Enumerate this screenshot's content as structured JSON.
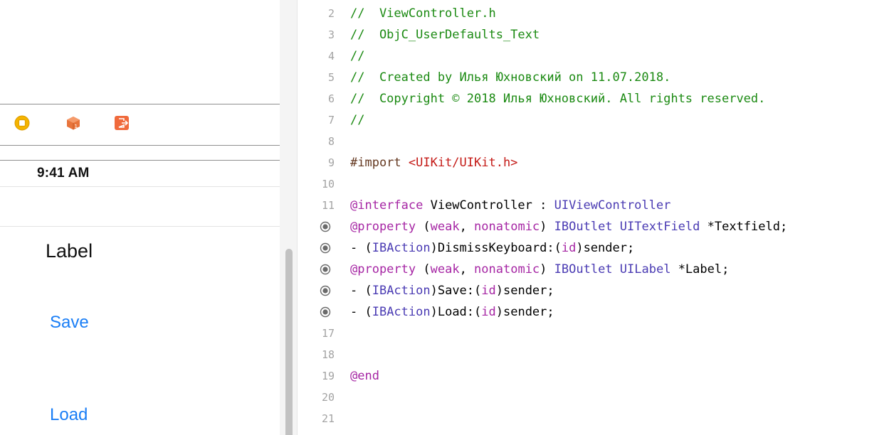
{
  "storyboard": {
    "dock_icons": [
      "view-controller-icon",
      "first-responder-icon",
      "exit-icon"
    ],
    "status_time": "9:41 AM",
    "label_text": "Label",
    "save_label": "Save",
    "load_label": "Load",
    "accent_color": "#1a7ef6"
  },
  "editor": {
    "lines": [
      {
        "num": "2",
        "connector": false,
        "segs": [
          {
            "c": "cmt",
            "t": "//  ViewController.h"
          }
        ]
      },
      {
        "num": "3",
        "connector": false,
        "segs": [
          {
            "c": "cmt",
            "t": "//  ObjC_UserDefaults_Text"
          }
        ]
      },
      {
        "num": "4",
        "connector": false,
        "segs": [
          {
            "c": "cmt",
            "t": "//"
          }
        ]
      },
      {
        "num": "5",
        "connector": false,
        "segs": [
          {
            "c": "cmt",
            "t": "//  Created by Илья Юхновский on 11.07.2018."
          }
        ]
      },
      {
        "num": "6",
        "connector": false,
        "segs": [
          {
            "c": "cmt",
            "t": "//  Copyright © 2018 Илья Юхновский. All rights reserved."
          }
        ]
      },
      {
        "num": "7",
        "connector": false,
        "segs": [
          {
            "c": "cmt",
            "t": "//"
          }
        ]
      },
      {
        "num": "8",
        "connector": false,
        "segs": []
      },
      {
        "num": "9",
        "connector": false,
        "segs": [
          {
            "c": "pp",
            "t": "#import "
          },
          {
            "c": "str",
            "t": "<UIKit/UIKit.h>"
          }
        ]
      },
      {
        "num": "10",
        "connector": false,
        "segs": []
      },
      {
        "num": "11",
        "connector": false,
        "segs": [
          {
            "c": "kw",
            "t": "@interface"
          },
          {
            "c": "pl",
            "t": " ViewController : "
          },
          {
            "c": "ty",
            "t": "UIViewController"
          }
        ]
      },
      {
        "num": "12",
        "connector": true,
        "segs": [
          {
            "c": "kw",
            "t": "@property"
          },
          {
            "c": "pl",
            "t": " ("
          },
          {
            "c": "kw",
            "t": "weak"
          },
          {
            "c": "pl",
            "t": ", "
          },
          {
            "c": "kw",
            "t": "nonatomic"
          },
          {
            "c": "pl",
            "t": ") "
          },
          {
            "c": "ty",
            "t": "IBOutlet"
          },
          {
            "c": "pl",
            "t": " "
          },
          {
            "c": "ty",
            "t": "UITextField"
          },
          {
            "c": "pl",
            "t": " *Textfield;"
          }
        ]
      },
      {
        "num": "13",
        "connector": true,
        "segs": [
          {
            "c": "pl",
            "t": "- ("
          },
          {
            "c": "ty",
            "t": "IBAction"
          },
          {
            "c": "pl",
            "t": ")DismissKeyboard:("
          },
          {
            "c": "kw",
            "t": "id"
          },
          {
            "c": "pl",
            "t": ")sender;"
          }
        ]
      },
      {
        "num": "14",
        "connector": true,
        "segs": [
          {
            "c": "kw",
            "t": "@property"
          },
          {
            "c": "pl",
            "t": " ("
          },
          {
            "c": "kw",
            "t": "weak"
          },
          {
            "c": "pl",
            "t": ", "
          },
          {
            "c": "kw",
            "t": "nonatomic"
          },
          {
            "c": "pl",
            "t": ") "
          },
          {
            "c": "ty",
            "t": "IBOutlet"
          },
          {
            "c": "pl",
            "t": " "
          },
          {
            "c": "ty",
            "t": "UILabel"
          },
          {
            "c": "pl",
            "t": " *Label;"
          }
        ]
      },
      {
        "num": "15",
        "connector": true,
        "segs": [
          {
            "c": "pl",
            "t": "- ("
          },
          {
            "c": "ty",
            "t": "IBAction"
          },
          {
            "c": "pl",
            "t": ")Save:("
          },
          {
            "c": "kw",
            "t": "id"
          },
          {
            "c": "pl",
            "t": ")sender;"
          }
        ]
      },
      {
        "num": "16",
        "connector": true,
        "segs": [
          {
            "c": "pl",
            "t": "- ("
          },
          {
            "c": "ty",
            "t": "IBAction"
          },
          {
            "c": "pl",
            "t": ")Load:("
          },
          {
            "c": "kw",
            "t": "id"
          },
          {
            "c": "pl",
            "t": ")sender;"
          }
        ]
      },
      {
        "num": "17",
        "connector": false,
        "segs": []
      },
      {
        "num": "18",
        "connector": false,
        "segs": []
      },
      {
        "num": "19",
        "connector": false,
        "segs": [
          {
            "c": "kw",
            "t": "@end"
          }
        ]
      },
      {
        "num": "20",
        "connector": false,
        "segs": []
      },
      {
        "num": "21",
        "connector": false,
        "segs": []
      }
    ]
  }
}
